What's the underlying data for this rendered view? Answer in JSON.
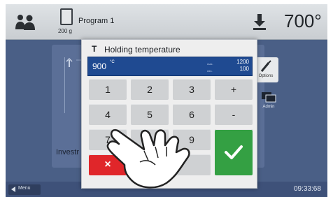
{
  "header": {
    "program_number": "200 g",
    "program_title": "Program 1",
    "temperature": "700°"
  },
  "background": {
    "investment_label": "Investr",
    "options_label": "Options",
    "admin_label": "Admin"
  },
  "footer": {
    "menu_label": "Menu",
    "clock": "09:33:68"
  },
  "dialog": {
    "title_icon": "T",
    "title": "Holding temperature",
    "value": "900",
    "unit": "°C",
    "max_label": "max.",
    "max_value": "1200",
    "min_label": "min.",
    "min_value": "100",
    "keys": {
      "k1": "1",
      "k2": "2",
      "k3": "3",
      "plus": "+",
      "k4": "4",
      "k5": "5",
      "k6": "6",
      "minus": "-",
      "k7": "7",
      "k8": "8",
      "k9": "9",
      "cancel": "×"
    }
  },
  "colors": {
    "accent_blue": "#1f4a91",
    "ok_green": "#34a043",
    "cancel_red": "#e0262a"
  },
  "icons": [
    "users-icon",
    "program-icon",
    "cooling-icon",
    "options-icon",
    "admin-icon",
    "checkmark-icon",
    "hand-pointer-icon"
  ]
}
